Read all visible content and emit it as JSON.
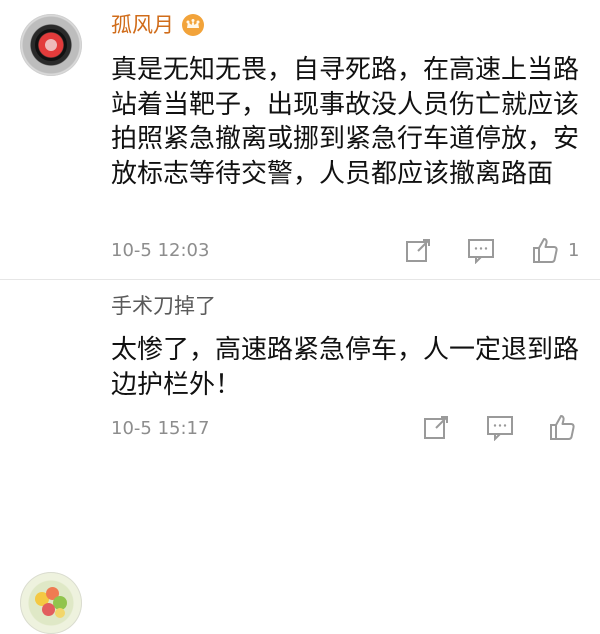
{
  "comments": [
    {
      "username": "孤风月",
      "text": "真是无知无畏，自寻死路，在高速上当路站着当靶子，出现事故没人员伤亡就应该拍照紧急撤离或挪到紧急行车道停放，安放标志等待交警，人员都应该撤离路面",
      "time": "10-5 12:03",
      "likes": "1",
      "username_color": "#d06c1a",
      "badge_icon": "crown-badge-icon",
      "avatar_icon": "car-wheel-avatar-icon",
      "actions": [
        "share-icon",
        "comment-icon",
        "thumb-up-icon"
      ]
    },
    {
      "username": "手术刀掉了",
      "text": "太惨了，高速路紧急停车，人一定退到路边护栏外！",
      "time": "10-5 15:17",
      "username_color": "#5a5a5a",
      "avatar_icon": "flower-avatar-icon",
      "actions": [
        "share-icon",
        "comment-icon",
        "thumb-up-icon"
      ]
    }
  ],
  "colors": {
    "background": "#ffffff",
    "text": "#111111",
    "meta": "#8d8d8d",
    "icon": "#9a9a9a",
    "divider": "#e6e6e6"
  }
}
